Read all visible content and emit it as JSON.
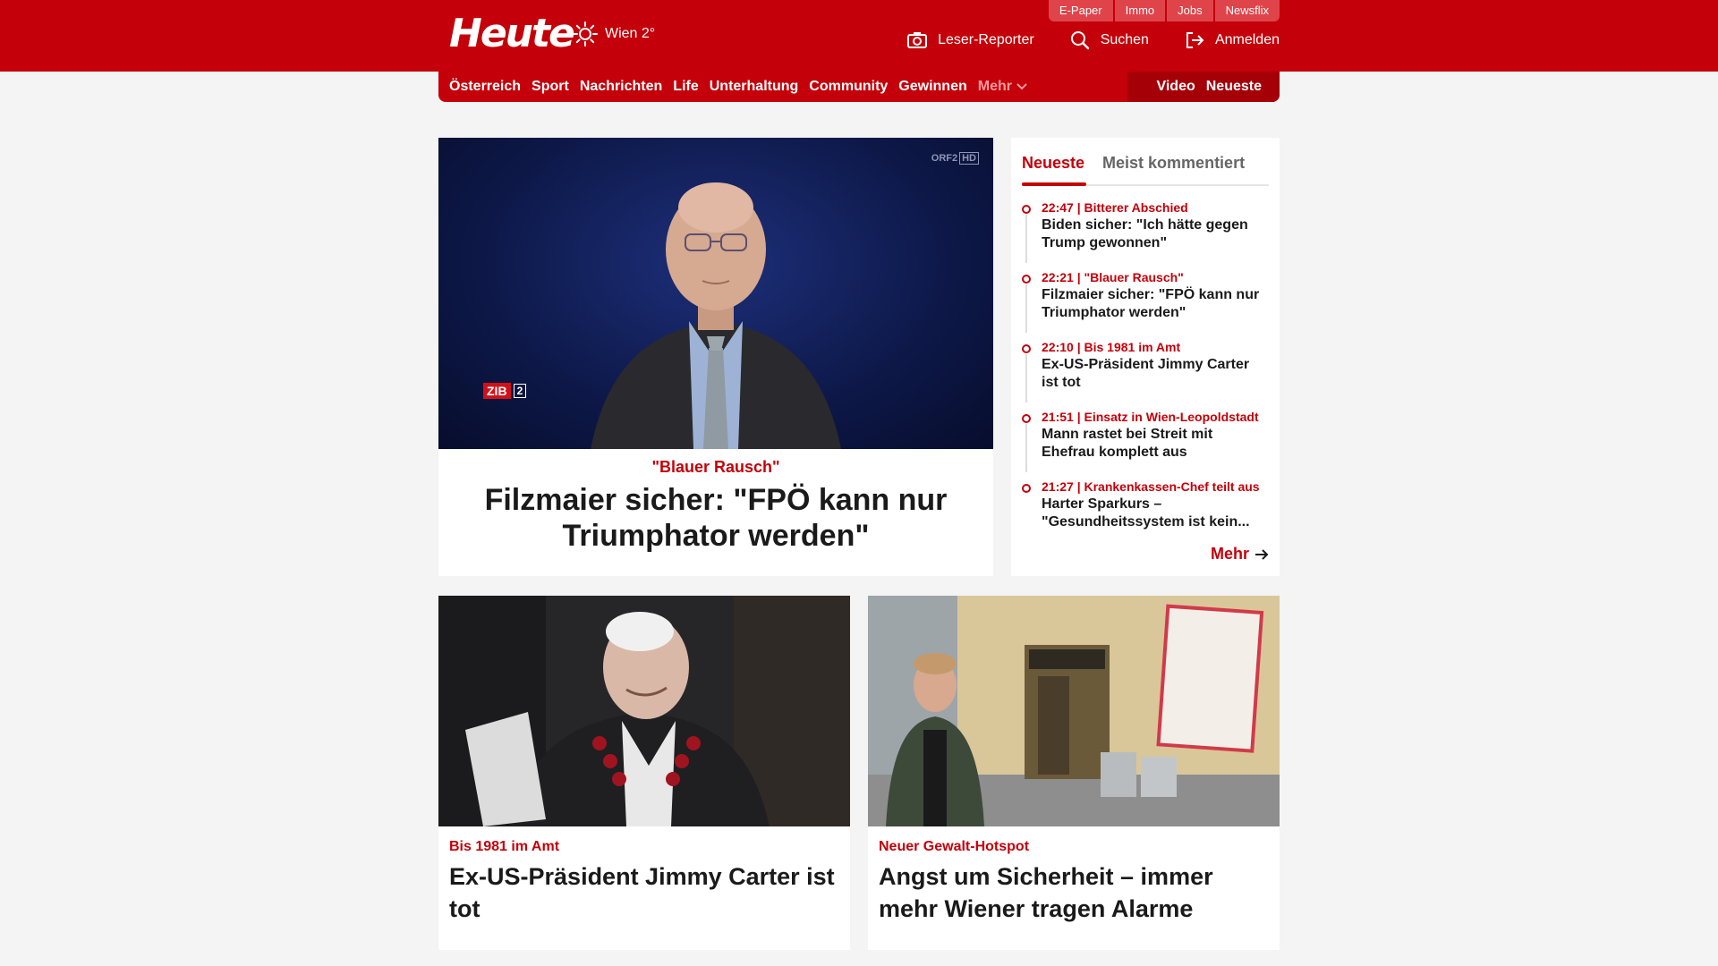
{
  "header": {
    "logo": "Heute",
    "weather": "Wien 2°",
    "service_links": [
      "E-Paper",
      "Immo",
      "Jobs",
      "Newsflix"
    ],
    "utility": {
      "reporter": "Leser-Reporter",
      "search": "Suchen",
      "login": "Anmelden"
    },
    "icons": [
      "sun-icon",
      "camera-icon",
      "search-icon",
      "login-icon"
    ]
  },
  "nav": {
    "items": [
      "Österreich",
      "Sport",
      "Nachrichten",
      "Life",
      "Unterhaltung",
      "Community",
      "Gewinnen"
    ],
    "more": "Mehr",
    "right": [
      "Video",
      "Neueste"
    ]
  },
  "hero": {
    "kicker": "\"Blauer Rausch\"",
    "title": "Filzmaier sicher: \"FPÖ kann nur Triumphator werden\"",
    "image_overlay": {
      "channel": "ORF2",
      "channel_hd": "HD",
      "show": "ZIB",
      "show_num": "2"
    }
  },
  "latest": {
    "tabs": [
      "Neueste",
      "Meist kommentiert"
    ],
    "items": [
      {
        "meta": "22:47 | Bitterer Abschied",
        "title": "Biden sicher: \"Ich hätte gegen Trump gewonnen\""
      },
      {
        "meta": "22:21 | \"Blauer Rausch\"",
        "title": "Filzmaier sicher: \"FPÖ kann nur Triumphator werden\""
      },
      {
        "meta": "22:10 | Bis 1981 im Amt",
        "title": "Ex-US-Präsident Jimmy Carter ist tot"
      },
      {
        "meta": "21:51 | Einsatz in Wien-Leopoldstadt",
        "title": "Mann rastet bei Streit mit Ehefrau komplett aus"
      },
      {
        "meta": "21:27 | Krankenkassen-Chef teilt aus",
        "title": "Harter Sparkurs – \"Gesundheitssystem ist kein..."
      }
    ],
    "more": "Mehr"
  },
  "cards": [
    {
      "kicker": "Bis 1981 im Amt",
      "title": "Ex-US-Präsident Jimmy Carter ist tot"
    },
    {
      "kicker": "Neuer Gewalt-Hotspot",
      "title": "Angst um Sicherheit – immer mehr Wiener tragen Alarme"
    }
  ],
  "colors": {
    "brand": "#c4000a",
    "background": "#f4f4f4"
  }
}
